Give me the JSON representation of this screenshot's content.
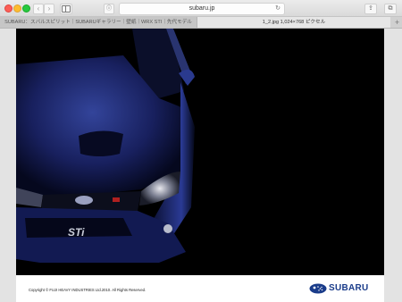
{
  "browser": {
    "address": "subaru.jp",
    "tabs": [
      {
        "label": "SUBARU：スバルスピリット｜SUBARUギャラリー｜壁紙｜WRX STI｜先代モデル"
      },
      {
        "label": "1_2.jpg 1,024×768 ピクセル"
      }
    ],
    "new_tab": "+"
  },
  "page": {
    "copyright": "Copyright © FUJI HEAVY INDUSTRIES Ltd.2010. All Rights Reserved.",
    "brand": "SUBARU",
    "car_badge": "STi"
  },
  "colors": {
    "car_blue": "#1c2a7a",
    "brand_blue": "#1a3c8a"
  }
}
